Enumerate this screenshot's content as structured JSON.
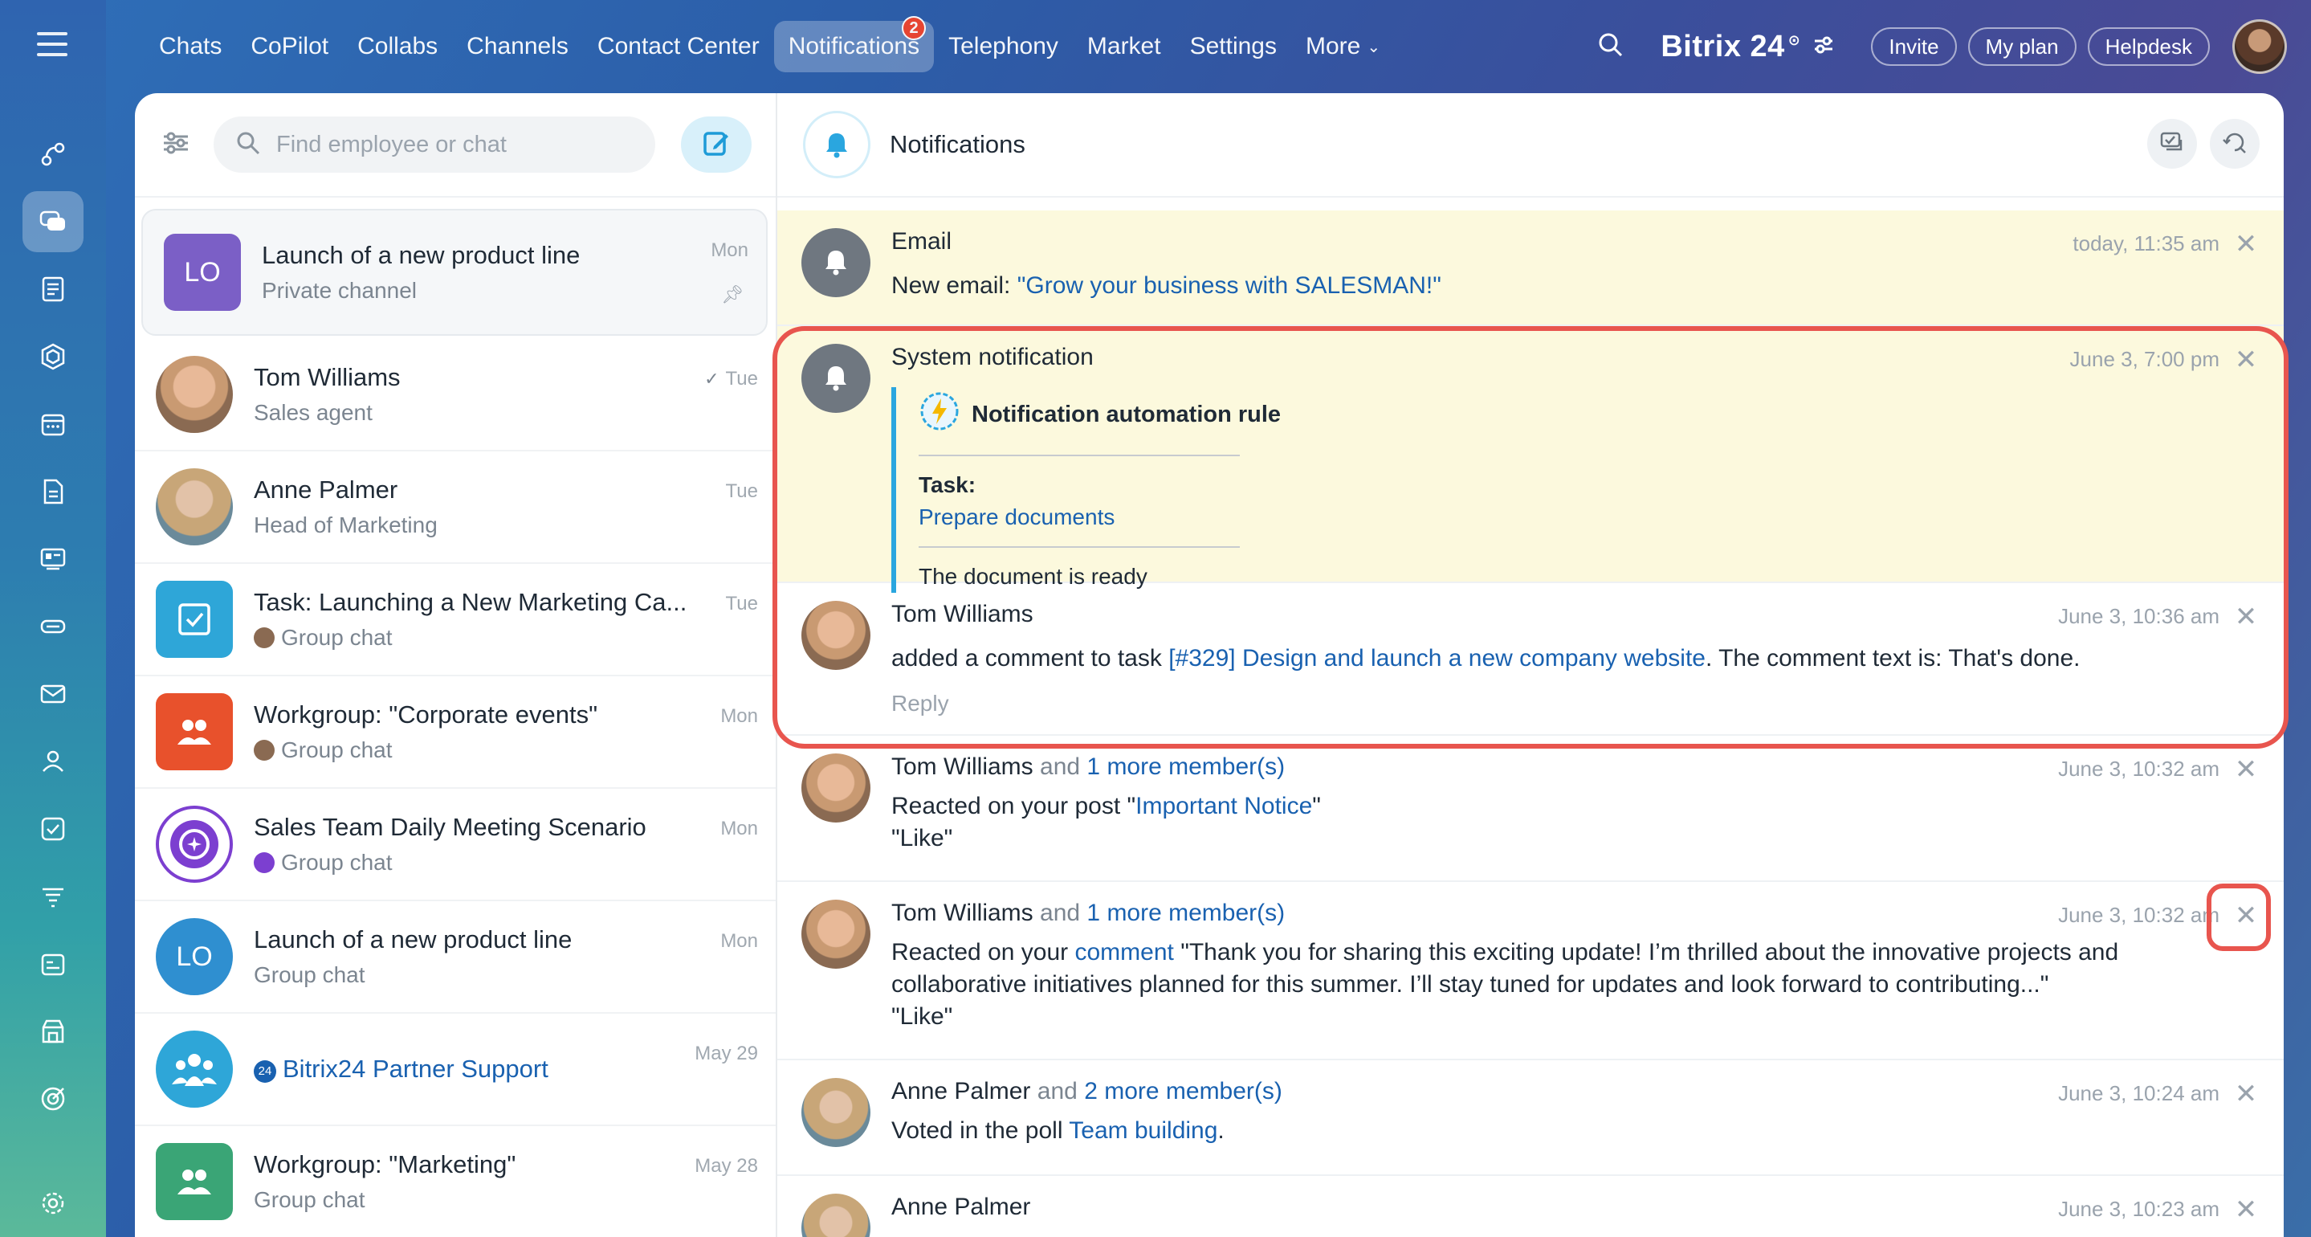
{
  "nav": {
    "items": [
      "Chats",
      "CoPilot",
      "Collabs",
      "Channels",
      "Contact Center",
      "Notifications",
      "Telephony",
      "Market",
      "Settings"
    ],
    "more_label": "More",
    "notifications_badge": "2",
    "brand": "Bitrix 24",
    "invite_label": "Invite",
    "myplan_label": "My plan",
    "helpdesk_label": "Helpdesk"
  },
  "search": {
    "placeholder": "Find employee or chat"
  },
  "chats": [
    {
      "title": "Launch of a new product line",
      "subtitle": "Private channel",
      "date": "Mon",
      "avatar_text": "LO",
      "avatar_color": "#7b5fc6"
    },
    {
      "title": "Tom Williams",
      "subtitle": "Sales agent",
      "date": "Tue"
    },
    {
      "title": "Anne Palmer",
      "subtitle": "Head of Marketing",
      "date": "Tue"
    },
    {
      "title": "Task: Launching a New Marketing Ca...",
      "subtitle": "Group chat",
      "date": "Tue"
    },
    {
      "title": "Workgroup: \"Corporate events\"",
      "subtitle": "Group chat",
      "date": "Mon"
    },
    {
      "title": "Sales Team Daily Meeting Scenario",
      "subtitle": "Group chat",
      "date": "Mon"
    },
    {
      "title": "Launch of a new product line",
      "subtitle": "Group chat",
      "date": "Mon",
      "avatar_text": "LO",
      "avatar_color": "#2f8fd0"
    },
    {
      "title": "Bitrix24 Partner Support",
      "subtitle": "",
      "date": "May 29"
    },
    {
      "title": "Workgroup: \"Marketing\"",
      "subtitle": "Group chat",
      "date": "May 28"
    }
  ],
  "panel": {
    "title": "Notifications"
  },
  "notifications": [
    {
      "title": "Email",
      "date": "today, 11:35 am",
      "text_prefix": "New email: ",
      "link": "\"Grow your business with SALESMAN!\""
    },
    {
      "title": "System notification",
      "date": "June 3, 7:00 pm",
      "attachment": {
        "heading": "Notification automation rule",
        "label": "Task:",
        "link": "Prepare documents",
        "text": "The document is ready"
      }
    },
    {
      "title": "Tom Williams",
      "date": "June 3, 10:36 am",
      "text_prefix": "added a comment to task ",
      "link": "[#329] Design and launch a new company website",
      "text_suffix": ". The comment text is: That's done.",
      "reply": "Reply"
    },
    {
      "title": "Tom Williams",
      "and": "and",
      "more": "1 more member(s)",
      "date": "June 3, 10:32 am",
      "text_prefix": "Reacted on your post \"",
      "link": "Important Notice",
      "text_suffix": "\"",
      "line2": "\"Like\""
    },
    {
      "title": "Tom Williams",
      "and": "and",
      "more": "1 more member(s)",
      "date": "June 3, 10:32 am",
      "text_prefix": "Reacted on your ",
      "link": "comment",
      "text_suffix": " \"Thank you for sharing this exciting update! I’m thrilled about the innovative projects and collaborative initiatives planned for this summer. I’ll stay tuned for updates and look forward to contributing...\"",
      "line2": "\"Like\""
    },
    {
      "title": "Anne Palmer",
      "and": "and",
      "more": "2 more member(s)",
      "date": "June 3, 10:24 am",
      "text_prefix": "Voted in the poll ",
      "link": "Team building",
      "text_suffix": "."
    },
    {
      "title": "Anne Palmer",
      "date": "June 3, 10:23 am"
    }
  ],
  "colors": {
    "accent": "#1961b0",
    "unread_bg": "#fcf9dd",
    "highlight": "#e8554e",
    "badge": "#f0442c"
  }
}
